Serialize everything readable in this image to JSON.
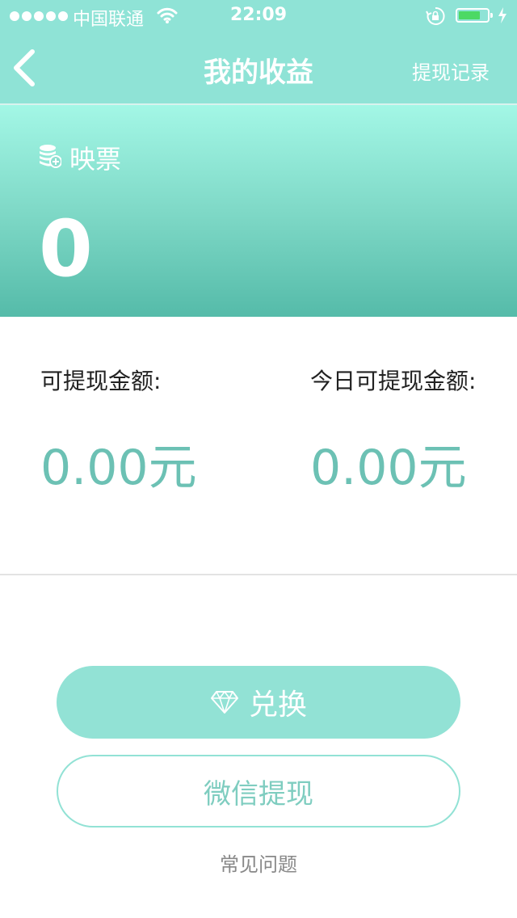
{
  "status_bar": {
    "carrier": "中国联通",
    "time": "22:09"
  },
  "nav": {
    "title": "我的收益",
    "record_link": "提现记录"
  },
  "hero": {
    "label": "映票",
    "value": "0"
  },
  "amounts": {
    "withdrawable_label": "可提现金额:",
    "withdrawable_value": "0.00元",
    "today_label": "今日可提现金额:",
    "today_value": "0.00元"
  },
  "buttons": {
    "exchange_label": "兑换",
    "withdraw_label": "微信提现"
  },
  "faq_label": "常见问题",
  "colors": {
    "accent": "#8fe3d6",
    "amount_text": "#6cc1b4",
    "battery": "#4cd964"
  }
}
